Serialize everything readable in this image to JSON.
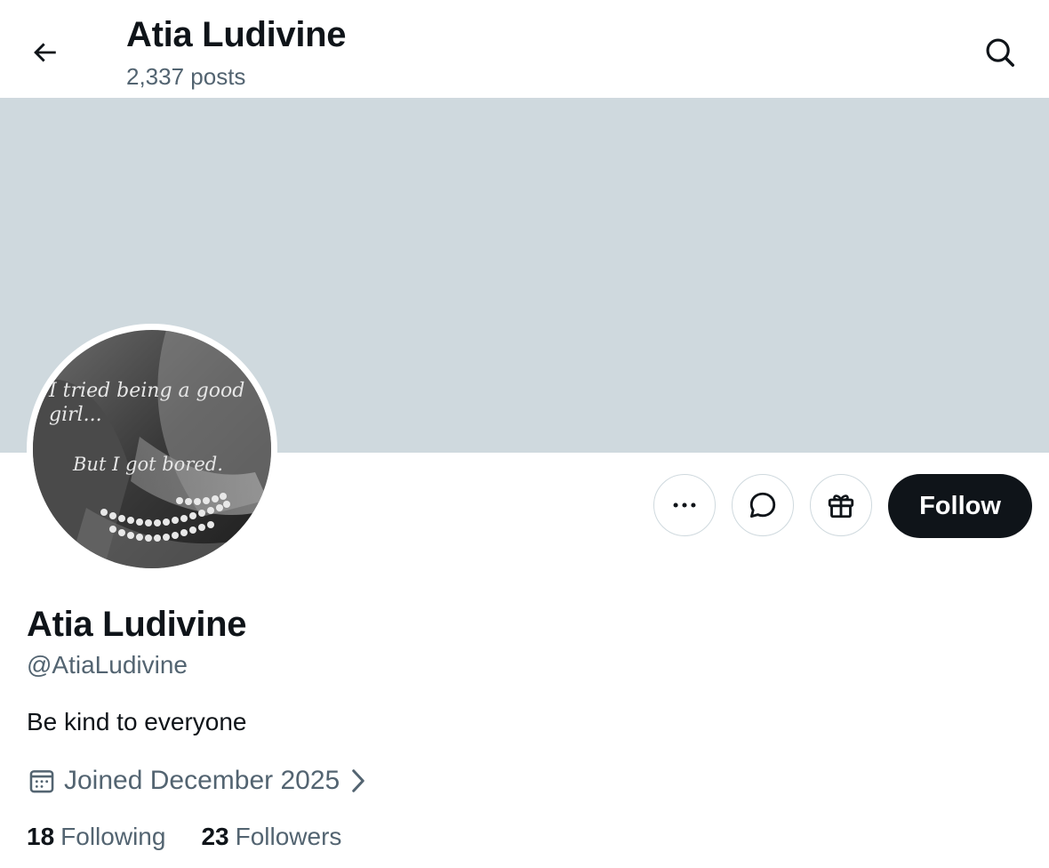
{
  "header": {
    "title": "Atia Ludivine",
    "post_count": "2,337 posts",
    "back_icon": "arrow-left-icon",
    "search_icon": "search-icon"
  },
  "avatar": {
    "text_line1": "I tried being a good",
    "text_line2": "girl...",
    "text_line3": "But I got bored."
  },
  "actions": {
    "more_icon": "more-icon",
    "message_icon": "message-icon",
    "gift_icon": "gift-icon",
    "follow_label": "Follow"
  },
  "profile": {
    "name": "Atia Ludivine",
    "handle": "@AtiaLudivine",
    "bio": "Be kind to everyone",
    "joined": "Joined December 2025",
    "following_count": "18",
    "following_label": "Following",
    "followers_count": "23",
    "followers_label": "Followers"
  },
  "colors": {
    "banner": "#cfd9de",
    "primary_text": "#0f1419",
    "secondary_text": "#536471",
    "follow_button": "#0f1419"
  }
}
